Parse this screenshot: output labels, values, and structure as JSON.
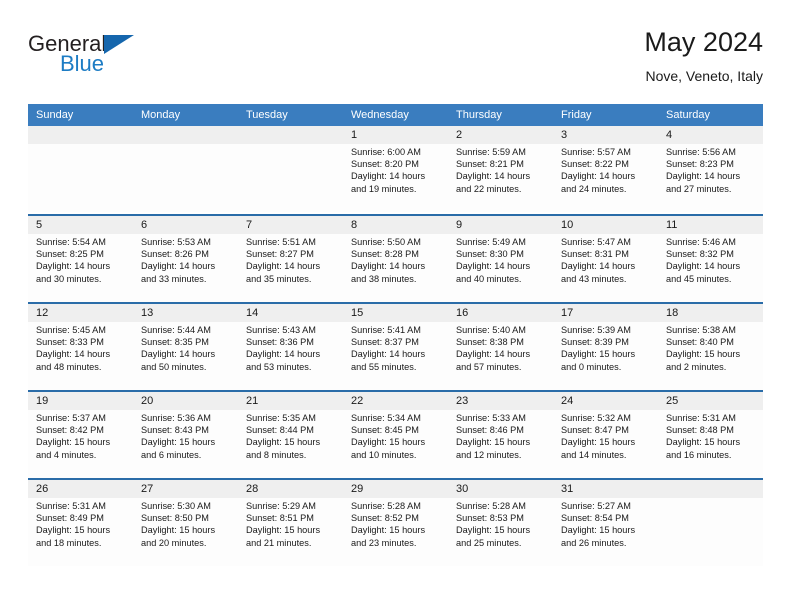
{
  "brand": {
    "word_general": "General",
    "word_blue": "Blue",
    "triangle_color": "#1566ad",
    "blue_text_color": "#1d7cc4"
  },
  "header": {
    "title": "May 2024",
    "subtitle": "Nove, Veneto, Italy"
  },
  "theme": {
    "header_bar": "#3a7dbf",
    "row_divider": "#2a6ca8",
    "day_number_band": "#efefef",
    "text": "#1a1a1a"
  },
  "weekday_headers": [
    "Sunday",
    "Monday",
    "Tuesday",
    "Wednesday",
    "Thursday",
    "Friday",
    "Saturday"
  ],
  "weeks": [
    {
      "days": [
        {
          "number": "",
          "sunrise": "",
          "sunset": "",
          "daylight_a": "",
          "daylight_b": "",
          "empty": true
        },
        {
          "number": "",
          "sunrise": "",
          "sunset": "",
          "daylight_a": "",
          "daylight_b": "",
          "empty": true
        },
        {
          "number": "",
          "sunrise": "",
          "sunset": "",
          "daylight_a": "",
          "daylight_b": "",
          "empty": true
        },
        {
          "number": "1",
          "sunrise": "Sunrise: 6:00 AM",
          "sunset": "Sunset: 8:20 PM",
          "daylight_a": "Daylight: 14 hours",
          "daylight_b": "and 19 minutes.",
          "empty": false
        },
        {
          "number": "2",
          "sunrise": "Sunrise: 5:59 AM",
          "sunset": "Sunset: 8:21 PM",
          "daylight_a": "Daylight: 14 hours",
          "daylight_b": "and 22 minutes.",
          "empty": false
        },
        {
          "number": "3",
          "sunrise": "Sunrise: 5:57 AM",
          "sunset": "Sunset: 8:22 PM",
          "daylight_a": "Daylight: 14 hours",
          "daylight_b": "and 24 minutes.",
          "empty": false
        },
        {
          "number": "4",
          "sunrise": "Sunrise: 5:56 AM",
          "sunset": "Sunset: 8:23 PM",
          "daylight_a": "Daylight: 14 hours",
          "daylight_b": "and 27 minutes.",
          "empty": false
        }
      ]
    },
    {
      "days": [
        {
          "number": "5",
          "sunrise": "Sunrise: 5:54 AM",
          "sunset": "Sunset: 8:25 PM",
          "daylight_a": "Daylight: 14 hours",
          "daylight_b": "and 30 minutes.",
          "empty": false
        },
        {
          "number": "6",
          "sunrise": "Sunrise: 5:53 AM",
          "sunset": "Sunset: 8:26 PM",
          "daylight_a": "Daylight: 14 hours",
          "daylight_b": "and 33 minutes.",
          "empty": false
        },
        {
          "number": "7",
          "sunrise": "Sunrise: 5:51 AM",
          "sunset": "Sunset: 8:27 PM",
          "daylight_a": "Daylight: 14 hours",
          "daylight_b": "and 35 minutes.",
          "empty": false
        },
        {
          "number": "8",
          "sunrise": "Sunrise: 5:50 AM",
          "sunset": "Sunset: 8:28 PM",
          "daylight_a": "Daylight: 14 hours",
          "daylight_b": "and 38 minutes.",
          "empty": false
        },
        {
          "number": "9",
          "sunrise": "Sunrise: 5:49 AM",
          "sunset": "Sunset: 8:30 PM",
          "daylight_a": "Daylight: 14 hours",
          "daylight_b": "and 40 minutes.",
          "empty": false
        },
        {
          "number": "10",
          "sunrise": "Sunrise: 5:47 AM",
          "sunset": "Sunset: 8:31 PM",
          "daylight_a": "Daylight: 14 hours",
          "daylight_b": "and 43 minutes.",
          "empty": false
        },
        {
          "number": "11",
          "sunrise": "Sunrise: 5:46 AM",
          "sunset": "Sunset: 8:32 PM",
          "daylight_a": "Daylight: 14 hours",
          "daylight_b": "and 45 minutes.",
          "empty": false
        }
      ]
    },
    {
      "days": [
        {
          "number": "12",
          "sunrise": "Sunrise: 5:45 AM",
          "sunset": "Sunset: 8:33 PM",
          "daylight_a": "Daylight: 14 hours",
          "daylight_b": "and 48 minutes.",
          "empty": false
        },
        {
          "number": "13",
          "sunrise": "Sunrise: 5:44 AM",
          "sunset": "Sunset: 8:35 PM",
          "daylight_a": "Daylight: 14 hours",
          "daylight_b": "and 50 minutes.",
          "empty": false
        },
        {
          "number": "14",
          "sunrise": "Sunrise: 5:43 AM",
          "sunset": "Sunset: 8:36 PM",
          "daylight_a": "Daylight: 14 hours",
          "daylight_b": "and 53 minutes.",
          "empty": false
        },
        {
          "number": "15",
          "sunrise": "Sunrise: 5:41 AM",
          "sunset": "Sunset: 8:37 PM",
          "daylight_a": "Daylight: 14 hours",
          "daylight_b": "and 55 minutes.",
          "empty": false
        },
        {
          "number": "16",
          "sunrise": "Sunrise: 5:40 AM",
          "sunset": "Sunset: 8:38 PM",
          "daylight_a": "Daylight: 14 hours",
          "daylight_b": "and 57 minutes.",
          "empty": false
        },
        {
          "number": "17",
          "sunrise": "Sunrise: 5:39 AM",
          "sunset": "Sunset: 8:39 PM",
          "daylight_a": "Daylight: 15 hours",
          "daylight_b": "and 0 minutes.",
          "empty": false
        },
        {
          "number": "18",
          "sunrise": "Sunrise: 5:38 AM",
          "sunset": "Sunset: 8:40 PM",
          "daylight_a": "Daylight: 15 hours",
          "daylight_b": "and 2 minutes.",
          "empty": false
        }
      ]
    },
    {
      "days": [
        {
          "number": "19",
          "sunrise": "Sunrise: 5:37 AM",
          "sunset": "Sunset: 8:42 PM",
          "daylight_a": "Daylight: 15 hours",
          "daylight_b": "and 4 minutes.",
          "empty": false
        },
        {
          "number": "20",
          "sunrise": "Sunrise: 5:36 AM",
          "sunset": "Sunset: 8:43 PM",
          "daylight_a": "Daylight: 15 hours",
          "daylight_b": "and 6 minutes.",
          "empty": false
        },
        {
          "number": "21",
          "sunrise": "Sunrise: 5:35 AM",
          "sunset": "Sunset: 8:44 PM",
          "daylight_a": "Daylight: 15 hours",
          "daylight_b": "and 8 minutes.",
          "empty": false
        },
        {
          "number": "22",
          "sunrise": "Sunrise: 5:34 AM",
          "sunset": "Sunset: 8:45 PM",
          "daylight_a": "Daylight: 15 hours",
          "daylight_b": "and 10 minutes.",
          "empty": false
        },
        {
          "number": "23",
          "sunrise": "Sunrise: 5:33 AM",
          "sunset": "Sunset: 8:46 PM",
          "daylight_a": "Daylight: 15 hours",
          "daylight_b": "and 12 minutes.",
          "empty": false
        },
        {
          "number": "24",
          "sunrise": "Sunrise: 5:32 AM",
          "sunset": "Sunset: 8:47 PM",
          "daylight_a": "Daylight: 15 hours",
          "daylight_b": "and 14 minutes.",
          "empty": false
        },
        {
          "number": "25",
          "sunrise": "Sunrise: 5:31 AM",
          "sunset": "Sunset: 8:48 PM",
          "daylight_a": "Daylight: 15 hours",
          "daylight_b": "and 16 minutes.",
          "empty": false
        }
      ]
    },
    {
      "days": [
        {
          "number": "26",
          "sunrise": "Sunrise: 5:31 AM",
          "sunset": "Sunset: 8:49 PM",
          "daylight_a": "Daylight: 15 hours",
          "daylight_b": "and 18 minutes.",
          "empty": false
        },
        {
          "number": "27",
          "sunrise": "Sunrise: 5:30 AM",
          "sunset": "Sunset: 8:50 PM",
          "daylight_a": "Daylight: 15 hours",
          "daylight_b": "and 20 minutes.",
          "empty": false
        },
        {
          "number": "28",
          "sunrise": "Sunrise: 5:29 AM",
          "sunset": "Sunset: 8:51 PM",
          "daylight_a": "Daylight: 15 hours",
          "daylight_b": "and 21 minutes.",
          "empty": false
        },
        {
          "number": "29",
          "sunrise": "Sunrise: 5:28 AM",
          "sunset": "Sunset: 8:52 PM",
          "daylight_a": "Daylight: 15 hours",
          "daylight_b": "and 23 minutes.",
          "empty": false
        },
        {
          "number": "30",
          "sunrise": "Sunrise: 5:28 AM",
          "sunset": "Sunset: 8:53 PM",
          "daylight_a": "Daylight: 15 hours",
          "daylight_b": "and 25 minutes.",
          "empty": false
        },
        {
          "number": "31",
          "sunrise": "Sunrise: 5:27 AM",
          "sunset": "Sunset: 8:54 PM",
          "daylight_a": "Daylight: 15 hours",
          "daylight_b": "and 26 minutes.",
          "empty": false
        },
        {
          "number": "",
          "sunrise": "",
          "sunset": "",
          "daylight_a": "",
          "daylight_b": "",
          "empty": true
        }
      ]
    }
  ]
}
